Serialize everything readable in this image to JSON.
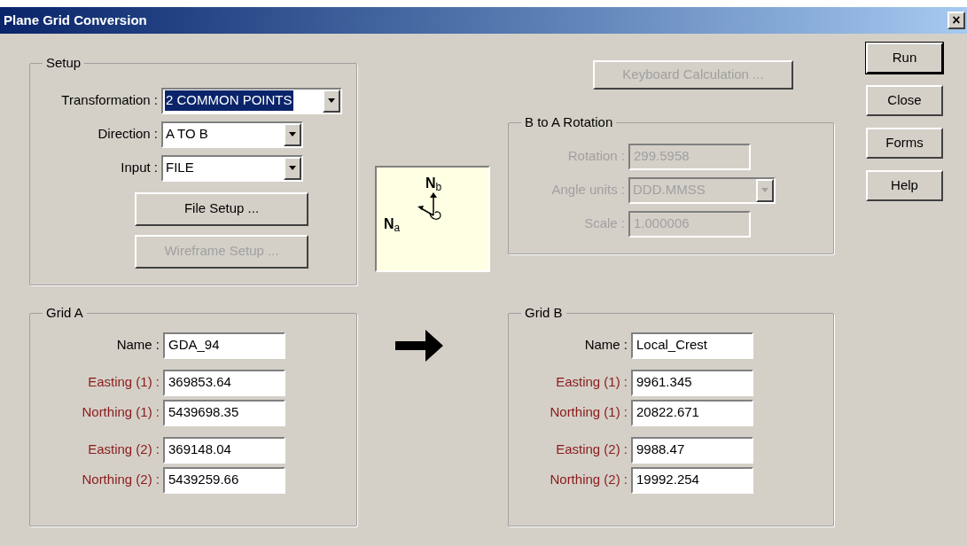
{
  "window": {
    "title": "Plane Grid Conversion",
    "close": "×"
  },
  "setup": {
    "title": "Setup",
    "fields": [
      {
        "label": "Transformation :",
        "value": "2 COMMON POINTS",
        "highlighted": true,
        "wide": true
      },
      {
        "label": "Direction :",
        "value": "A TO B",
        "highlighted": false,
        "wide": false
      },
      {
        "label": "Input :",
        "value": "FILE",
        "highlighted": false,
        "wide": false
      }
    ],
    "buttons": [
      {
        "label": "File Setup ...",
        "disabled": false
      },
      {
        "label": "Wireframe Setup ...",
        "disabled": true
      }
    ]
  },
  "keyboard_button": {
    "label": "Keyboard Calculation ...",
    "disabled": true
  },
  "north_diagram": {
    "label_a": "**N**$_{a}$",
    "label_b": "**N**$_{b}$"
  },
  "rotation": {
    "title": "B to A Rotation",
    "disabled": true,
    "fields": [
      {
        "kind": "text",
        "label": "Rotation :",
        "value": "299.5958"
      },
      {
        "kind": "dropdown",
        "label": "Angle units :",
        "value": "DDD.MMSS"
      },
      {
        "kind": "text",
        "label": "Scale :",
        "value": "1.000006"
      }
    ]
  },
  "grid_a": {
    "title": "Grid A",
    "fields": [
      {
        "label": "Name :",
        "value": "GDA_94",
        "color": "#000000"
      },
      {
        "label": "Easting (1) :",
        "value": "369853.64",
        "color": "#8b1a1a"
      },
      {
        "label": "Northing (1) :",
        "value": "5439698.35",
        "color": "#8b1a1a"
      },
      {
        "label": "Easting (2) :",
        "value": "369148.04",
        "color": "#8b1a1a"
      },
      {
        "label": "Northing (2) :",
        "value": "5439259.66",
        "color": "#8b1a1a"
      }
    ]
  },
  "grid_b": {
    "title": "Grid B",
    "fields": [
      {
        "label": "Name :",
        "value": "Local_Crest",
        "color": "#000000"
      },
      {
        "label": "Easting (1) :",
        "value": "9961.345",
        "color": "#8b1a1a"
      },
      {
        "label": "Northing (1) :",
        "value": "20822.671",
        "color": "#8b1a1a"
      },
      {
        "label": "Easting (2) :",
        "value": "9988.47",
        "color": "#8b1a1a"
      },
      {
        "label": "Northing (2) :",
        "value": "19992.254",
        "color": "#8b1a1a"
      }
    ]
  },
  "side_buttons": [
    {
      "label": "Run",
      "default": true
    },
    {
      "label": "Close",
      "default": false
    },
    {
      "label": "Forms",
      "default": false
    },
    {
      "label": "Help",
      "default": false
    }
  ]
}
